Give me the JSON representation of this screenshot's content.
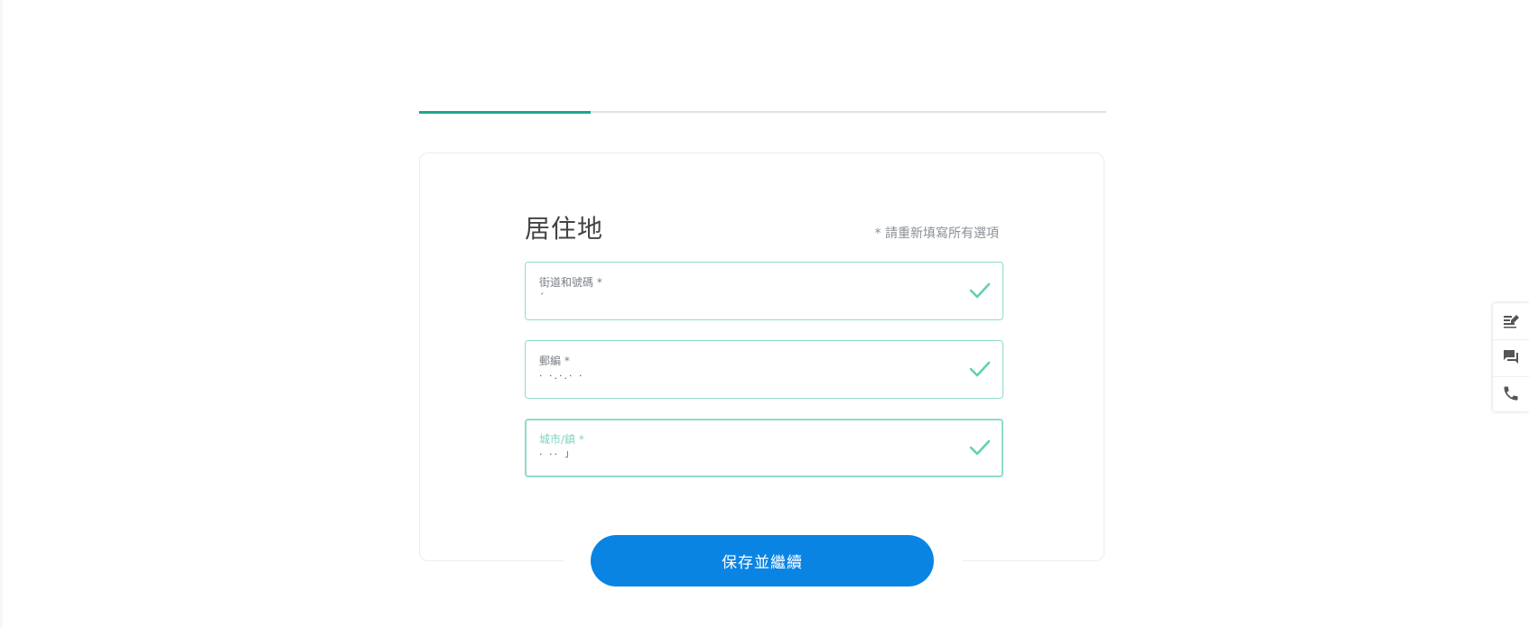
{
  "progress": {
    "fraction": 0.25,
    "fill_color": "#1aa890",
    "track_color": "#e2e2e2"
  },
  "form": {
    "title": "居住地",
    "required_note": "* 請重新填寫所有選項",
    "fields": [
      {
        "label": "街道和號碼 *",
        "value": "ˊ",
        "status": "valid"
      },
      {
        "label": "郵編 *",
        "value": "· ·.·.· ·",
        "status": "valid"
      },
      {
        "label": "城市/鎮 *",
        "value": "· ·· ˩",
        "status": "valid",
        "focused": true
      }
    ],
    "submit_label": "保存並繼續"
  },
  "side_toolbar": {
    "items": [
      {
        "icon": "edit-note-icon"
      },
      {
        "icon": "chat-icon"
      },
      {
        "icon": "phone-icon"
      }
    ]
  },
  "colors": {
    "accent": "#0a84e3",
    "valid_border": "#8fdccc",
    "check": "#5fd1b4"
  }
}
